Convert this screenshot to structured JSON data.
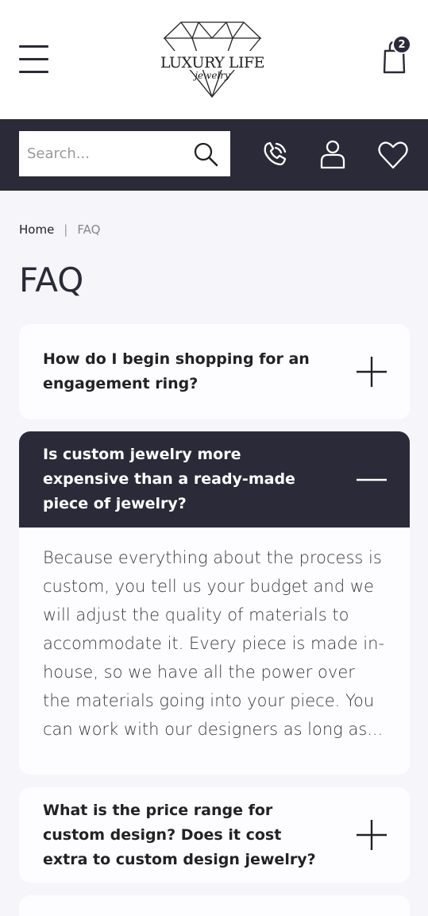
{
  "header": {
    "logo_text": "LUXURY LIFE",
    "logo_script": "jewelry",
    "cart_count": "2"
  },
  "search": {
    "placeholder": "Search..."
  },
  "breadcrumb": {
    "home": "Home",
    "separator": "|",
    "current": "FAQ"
  },
  "page": {
    "title": "FAQ"
  },
  "faq": [
    {
      "question": "How do I begin shopping for an engagement ring?",
      "open": false
    },
    {
      "question": "Is custom jewelry more expensive than a ready-made piece of jewelry?",
      "answer": "Because everything about the process is custom, you tell us your budget and we will adjust the quality of materials to accommodate it. Every piece is made in-house, so we have all the power over the materials going into your piece. You can work with our designers as long as...",
      "open": true
    },
    {
      "question": "What is the price range for custom design? Does it cost extra to custom design jewelry?",
      "open": false
    }
  ],
  "colors": {
    "dark": "#2b2a38",
    "background": "#f6f5fa",
    "card": "#fdfcff"
  },
  "icons": [
    "menu-icon",
    "diamond-logo-icon",
    "cart-icon",
    "search-icon",
    "phone-icon",
    "user-icon",
    "heart-icon",
    "plus-icon",
    "minus-icon"
  ]
}
